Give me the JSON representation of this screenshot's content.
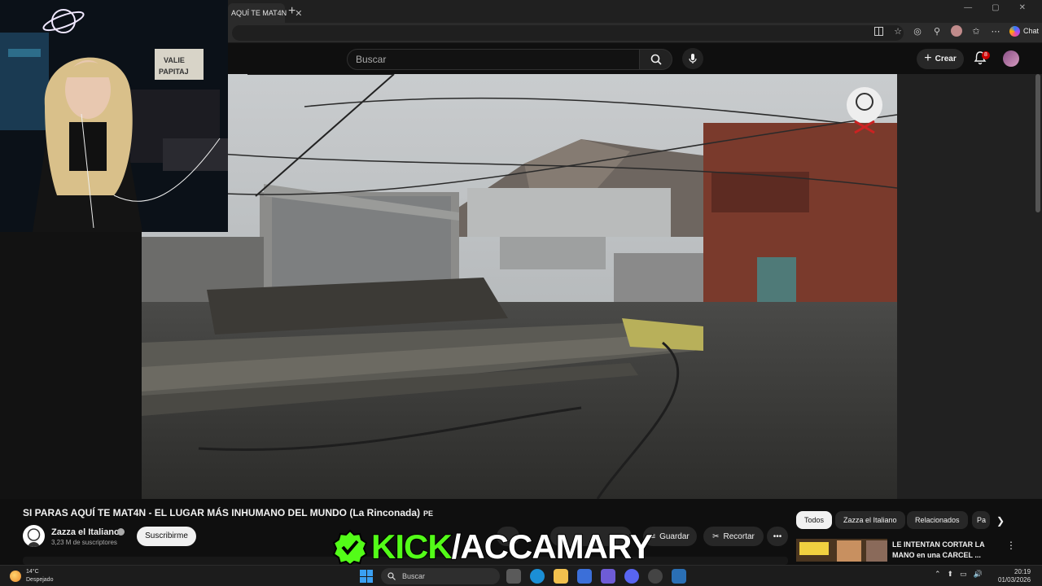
{
  "browser": {
    "tab_title": "AQUÍ TE MAT4N",
    "tab_close": "✕",
    "new_tab": "+",
    "window_controls": [
      "—",
      "▢",
      "✕"
    ],
    "chat_label": "Chat"
  },
  "youtube": {
    "search_placeholder": "Buscar",
    "create_label": "Crear",
    "notifications_count": "8"
  },
  "video": {
    "title": "SI PARAS AQUÍ TE MAT4N - EL LUGAR MÁS INHUMANO DEL MUNDO (La Rinconada)",
    "flag_text": "PE",
    "channel_name": "Zazza el Italiano",
    "subscribers": "3,23 M de suscriptores",
    "subscribe_label": "Suscribirme",
    "save_label": "Guardar",
    "clip_label": "Recortar",
    "more_label": "•••"
  },
  "chips": [
    "Todos",
    "Zazza el Italiano",
    "Relacionados",
    "Pa"
  ],
  "recommended": {
    "title": "LE INTENTAN CORTAR LA MANO en una CARCEL ..."
  },
  "overlay": {
    "kick_brand": "KICK",
    "kick_slash": "/",
    "kick_channel": "ACCAMARY",
    "webcam_sign_line1": "VALIE",
    "webcam_sign_line2": "PAPITAJ"
  },
  "taskbar": {
    "temperature": "14°C",
    "weather": "Despejado",
    "search_label": "Buscar",
    "time": "20:19",
    "date": "01/03/2026"
  },
  "colors": {
    "kick_green": "#53fc18",
    "youtube_bg": "#0f0f0f",
    "badge_red": "#cc0000"
  }
}
